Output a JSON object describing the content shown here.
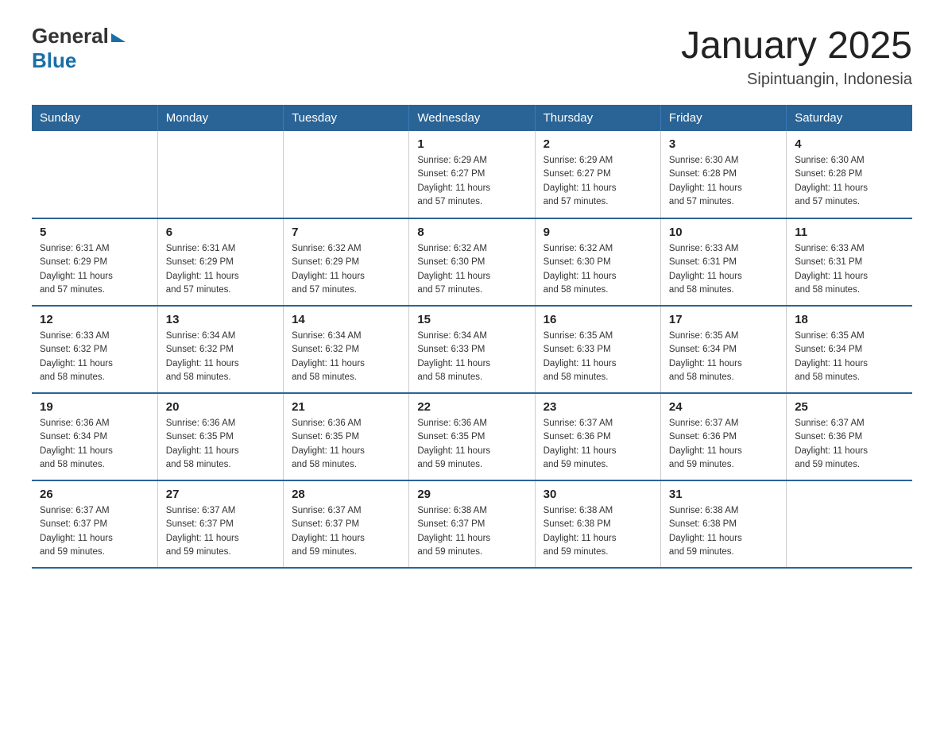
{
  "header": {
    "logo_general": "General",
    "logo_blue": "Blue",
    "title": "January 2025",
    "location": "Sipintuangin, Indonesia"
  },
  "days_of_week": [
    "Sunday",
    "Monday",
    "Tuesday",
    "Wednesday",
    "Thursday",
    "Friday",
    "Saturday"
  ],
  "weeks": [
    {
      "days": [
        {
          "number": "",
          "info": ""
        },
        {
          "number": "",
          "info": ""
        },
        {
          "number": "",
          "info": ""
        },
        {
          "number": "1",
          "info": "Sunrise: 6:29 AM\nSunset: 6:27 PM\nDaylight: 11 hours\nand 57 minutes."
        },
        {
          "number": "2",
          "info": "Sunrise: 6:29 AM\nSunset: 6:27 PM\nDaylight: 11 hours\nand 57 minutes."
        },
        {
          "number": "3",
          "info": "Sunrise: 6:30 AM\nSunset: 6:28 PM\nDaylight: 11 hours\nand 57 minutes."
        },
        {
          "number": "4",
          "info": "Sunrise: 6:30 AM\nSunset: 6:28 PM\nDaylight: 11 hours\nand 57 minutes."
        }
      ]
    },
    {
      "days": [
        {
          "number": "5",
          "info": "Sunrise: 6:31 AM\nSunset: 6:29 PM\nDaylight: 11 hours\nand 57 minutes."
        },
        {
          "number": "6",
          "info": "Sunrise: 6:31 AM\nSunset: 6:29 PM\nDaylight: 11 hours\nand 57 minutes."
        },
        {
          "number": "7",
          "info": "Sunrise: 6:32 AM\nSunset: 6:29 PM\nDaylight: 11 hours\nand 57 minutes."
        },
        {
          "number": "8",
          "info": "Sunrise: 6:32 AM\nSunset: 6:30 PM\nDaylight: 11 hours\nand 57 minutes."
        },
        {
          "number": "9",
          "info": "Sunrise: 6:32 AM\nSunset: 6:30 PM\nDaylight: 11 hours\nand 58 minutes."
        },
        {
          "number": "10",
          "info": "Sunrise: 6:33 AM\nSunset: 6:31 PM\nDaylight: 11 hours\nand 58 minutes."
        },
        {
          "number": "11",
          "info": "Sunrise: 6:33 AM\nSunset: 6:31 PM\nDaylight: 11 hours\nand 58 minutes."
        }
      ]
    },
    {
      "days": [
        {
          "number": "12",
          "info": "Sunrise: 6:33 AM\nSunset: 6:32 PM\nDaylight: 11 hours\nand 58 minutes."
        },
        {
          "number": "13",
          "info": "Sunrise: 6:34 AM\nSunset: 6:32 PM\nDaylight: 11 hours\nand 58 minutes."
        },
        {
          "number": "14",
          "info": "Sunrise: 6:34 AM\nSunset: 6:32 PM\nDaylight: 11 hours\nand 58 minutes."
        },
        {
          "number": "15",
          "info": "Sunrise: 6:34 AM\nSunset: 6:33 PM\nDaylight: 11 hours\nand 58 minutes."
        },
        {
          "number": "16",
          "info": "Sunrise: 6:35 AM\nSunset: 6:33 PM\nDaylight: 11 hours\nand 58 minutes."
        },
        {
          "number": "17",
          "info": "Sunrise: 6:35 AM\nSunset: 6:34 PM\nDaylight: 11 hours\nand 58 minutes."
        },
        {
          "number": "18",
          "info": "Sunrise: 6:35 AM\nSunset: 6:34 PM\nDaylight: 11 hours\nand 58 minutes."
        }
      ]
    },
    {
      "days": [
        {
          "number": "19",
          "info": "Sunrise: 6:36 AM\nSunset: 6:34 PM\nDaylight: 11 hours\nand 58 minutes."
        },
        {
          "number": "20",
          "info": "Sunrise: 6:36 AM\nSunset: 6:35 PM\nDaylight: 11 hours\nand 58 minutes."
        },
        {
          "number": "21",
          "info": "Sunrise: 6:36 AM\nSunset: 6:35 PM\nDaylight: 11 hours\nand 58 minutes."
        },
        {
          "number": "22",
          "info": "Sunrise: 6:36 AM\nSunset: 6:35 PM\nDaylight: 11 hours\nand 59 minutes."
        },
        {
          "number": "23",
          "info": "Sunrise: 6:37 AM\nSunset: 6:36 PM\nDaylight: 11 hours\nand 59 minutes."
        },
        {
          "number": "24",
          "info": "Sunrise: 6:37 AM\nSunset: 6:36 PM\nDaylight: 11 hours\nand 59 minutes."
        },
        {
          "number": "25",
          "info": "Sunrise: 6:37 AM\nSunset: 6:36 PM\nDaylight: 11 hours\nand 59 minutes."
        }
      ]
    },
    {
      "days": [
        {
          "number": "26",
          "info": "Sunrise: 6:37 AM\nSunset: 6:37 PM\nDaylight: 11 hours\nand 59 minutes."
        },
        {
          "number": "27",
          "info": "Sunrise: 6:37 AM\nSunset: 6:37 PM\nDaylight: 11 hours\nand 59 minutes."
        },
        {
          "number": "28",
          "info": "Sunrise: 6:37 AM\nSunset: 6:37 PM\nDaylight: 11 hours\nand 59 minutes."
        },
        {
          "number": "29",
          "info": "Sunrise: 6:38 AM\nSunset: 6:37 PM\nDaylight: 11 hours\nand 59 minutes."
        },
        {
          "number": "30",
          "info": "Sunrise: 6:38 AM\nSunset: 6:38 PM\nDaylight: 11 hours\nand 59 minutes."
        },
        {
          "number": "31",
          "info": "Sunrise: 6:38 AM\nSunset: 6:38 PM\nDaylight: 11 hours\nand 59 minutes."
        },
        {
          "number": "",
          "info": ""
        }
      ]
    }
  ]
}
